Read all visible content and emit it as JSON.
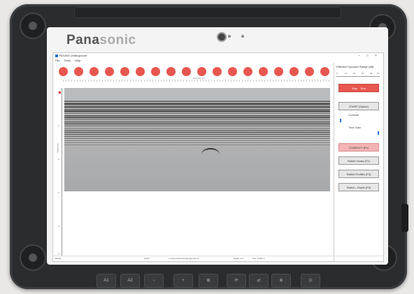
{
  "device": {
    "brand_bold": "Pana",
    "brand_faded": "sonic",
    "hardware_buttons": [
      "A1",
      "A2",
      "−",
      "+",
      "⊞",
      "⟳",
      "⇄",
      "⊕",
      "⏻"
    ]
  },
  "window": {
    "title": "RD1500 Underground",
    "controls": [
      "–",
      "□",
      "×"
    ],
    "menu": [
      "File",
      "Tools",
      "Help"
    ]
  },
  "scan": {
    "marker_count": 18,
    "marker_color": "#e8574f",
    "top_axis_label": "Distance (m)",
    "y_axis_label": "Depth (m)",
    "y_ticks": [
      "0",
      "1",
      "2",
      "3",
      "4",
      "5"
    ]
  },
  "side_panel": {
    "range_title": "Effective Dynamic Range (dB)",
    "range_scale": [
      "0",
      "10",
      "20",
      "30",
      "40",
      "50"
    ],
    "stop_label": "Stop",
    "run_label": "Run",
    "start_label": "START (Space)",
    "contrast_label": "Contrast",
    "time_gain_label": "Time Gain",
    "buttons": [
      "COMPLET (F1)",
      "Switch Grass (F2)",
      "Switch Profiles (F4)",
      "Switch - Depth (F3)"
    ]
  },
  "status": {
    "left": "Ready",
    "center": "C:\\Users\\Scans\\Underground.rd",
    "depth": "Depth: 0.0",
    "pos": "Pos: 0.000 m",
    "mid_marker": "0.000"
  }
}
